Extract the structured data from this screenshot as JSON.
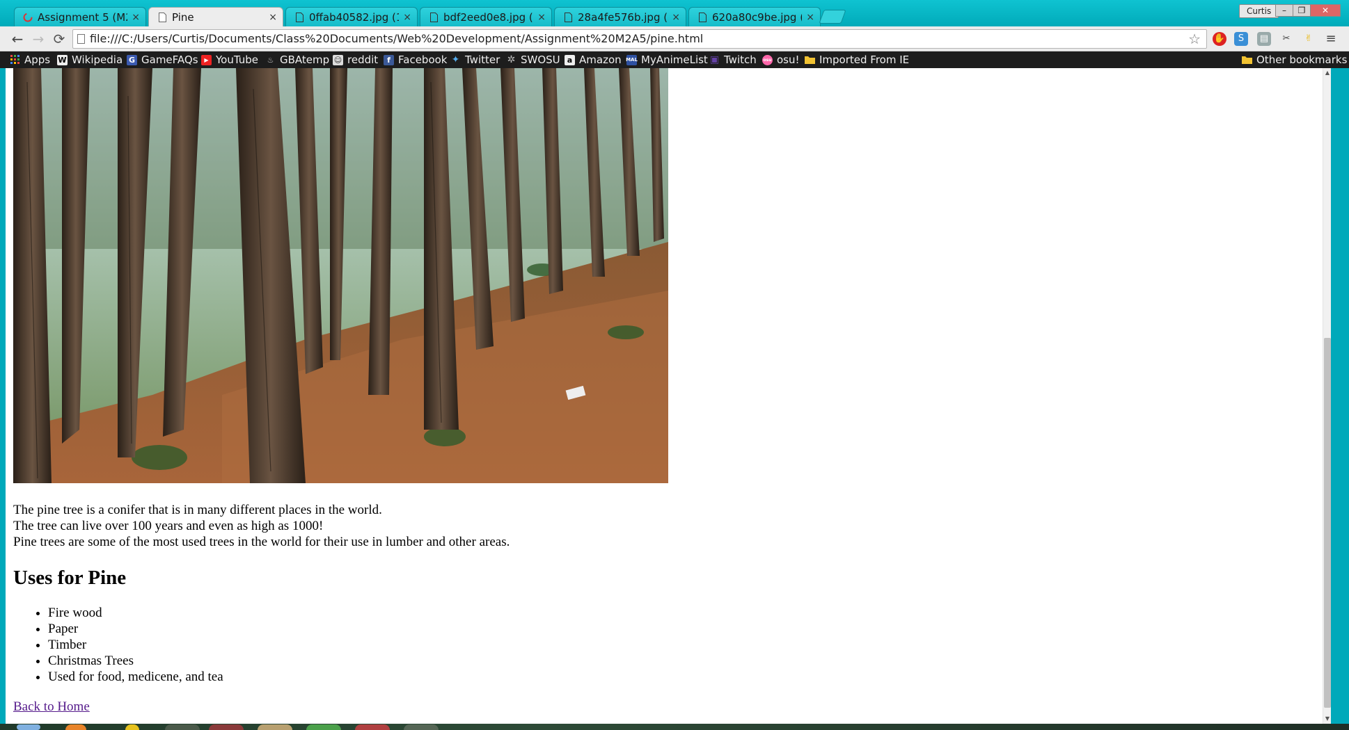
{
  "browser": {
    "tabs": [
      {
        "title": "Assignment 5 (M2A5",
        "icon": "loading-spinner-icon",
        "active": false
      },
      {
        "title": "Pine",
        "icon": "page-icon",
        "active": true
      },
      {
        "title": "0ffab40582.jpg (193",
        "icon": "page-icon",
        "active": false
      },
      {
        "title": "bdf2eed0e8.jpg (193",
        "icon": "page-icon",
        "active": false
      },
      {
        "title": "28a4fe576b.jpg (193",
        "icon": "page-icon",
        "active": false
      },
      {
        "title": "620a80c9be.jpg (193",
        "icon": "page-icon",
        "active": false
      }
    ],
    "tab_close_glyph": "×",
    "profile_name": "Curtis",
    "window_buttons": {
      "minimize": "–",
      "maximize": "❐",
      "close": "✕"
    },
    "url": "file:///C:/Users/Curtis/Documents/Class%20Documents/Web%20Development/Assignment%20M2A5/pine.html",
    "accent_color": "#00a9ba"
  },
  "bookmarks": {
    "items": [
      {
        "label": "Apps",
        "icon": "apps-grid-icon"
      },
      {
        "label": "Wikipedia",
        "icon": "wikipedia-icon"
      },
      {
        "label": "GameFAQs",
        "icon": "gamefaqs-icon"
      },
      {
        "label": "YouTube",
        "icon": "youtube-icon"
      },
      {
        "label": "GBAtemp",
        "icon": "gbatemp-icon"
      },
      {
        "label": "reddit",
        "icon": "reddit-icon"
      },
      {
        "label": "Facebook",
        "icon": "facebook-icon"
      },
      {
        "label": "Twitter",
        "icon": "twitter-icon"
      },
      {
        "label": "SWOSU",
        "icon": "swosu-icon"
      },
      {
        "label": "Amazon",
        "icon": "amazon-icon"
      },
      {
        "label": "MyAnimeList",
        "icon": "myanimelist-icon"
      },
      {
        "label": "Twitch",
        "icon": "twitch-icon"
      },
      {
        "label": "osu!",
        "icon": "osu-icon"
      },
      {
        "label": "Imported From IE",
        "icon": "folder-icon"
      }
    ],
    "other": {
      "label": "Other bookmarks",
      "icon": "folder-icon"
    }
  },
  "page": {
    "hero_image": "pine-forest-photo",
    "paragraph_lines": [
      "The pine tree is a conifer that is in many different places in the world.",
      "The tree can live over 100 years and even as high as 1000!",
      "Pine trees are some of the most used trees in the world for their use in lumber and other areas."
    ],
    "uses_heading": "Uses for Pine",
    "uses": [
      "Fire wood",
      "Paper",
      "Timber",
      "Christmas Trees",
      "Used for food, medicene, and tea"
    ],
    "back_link": "Back to Home"
  }
}
